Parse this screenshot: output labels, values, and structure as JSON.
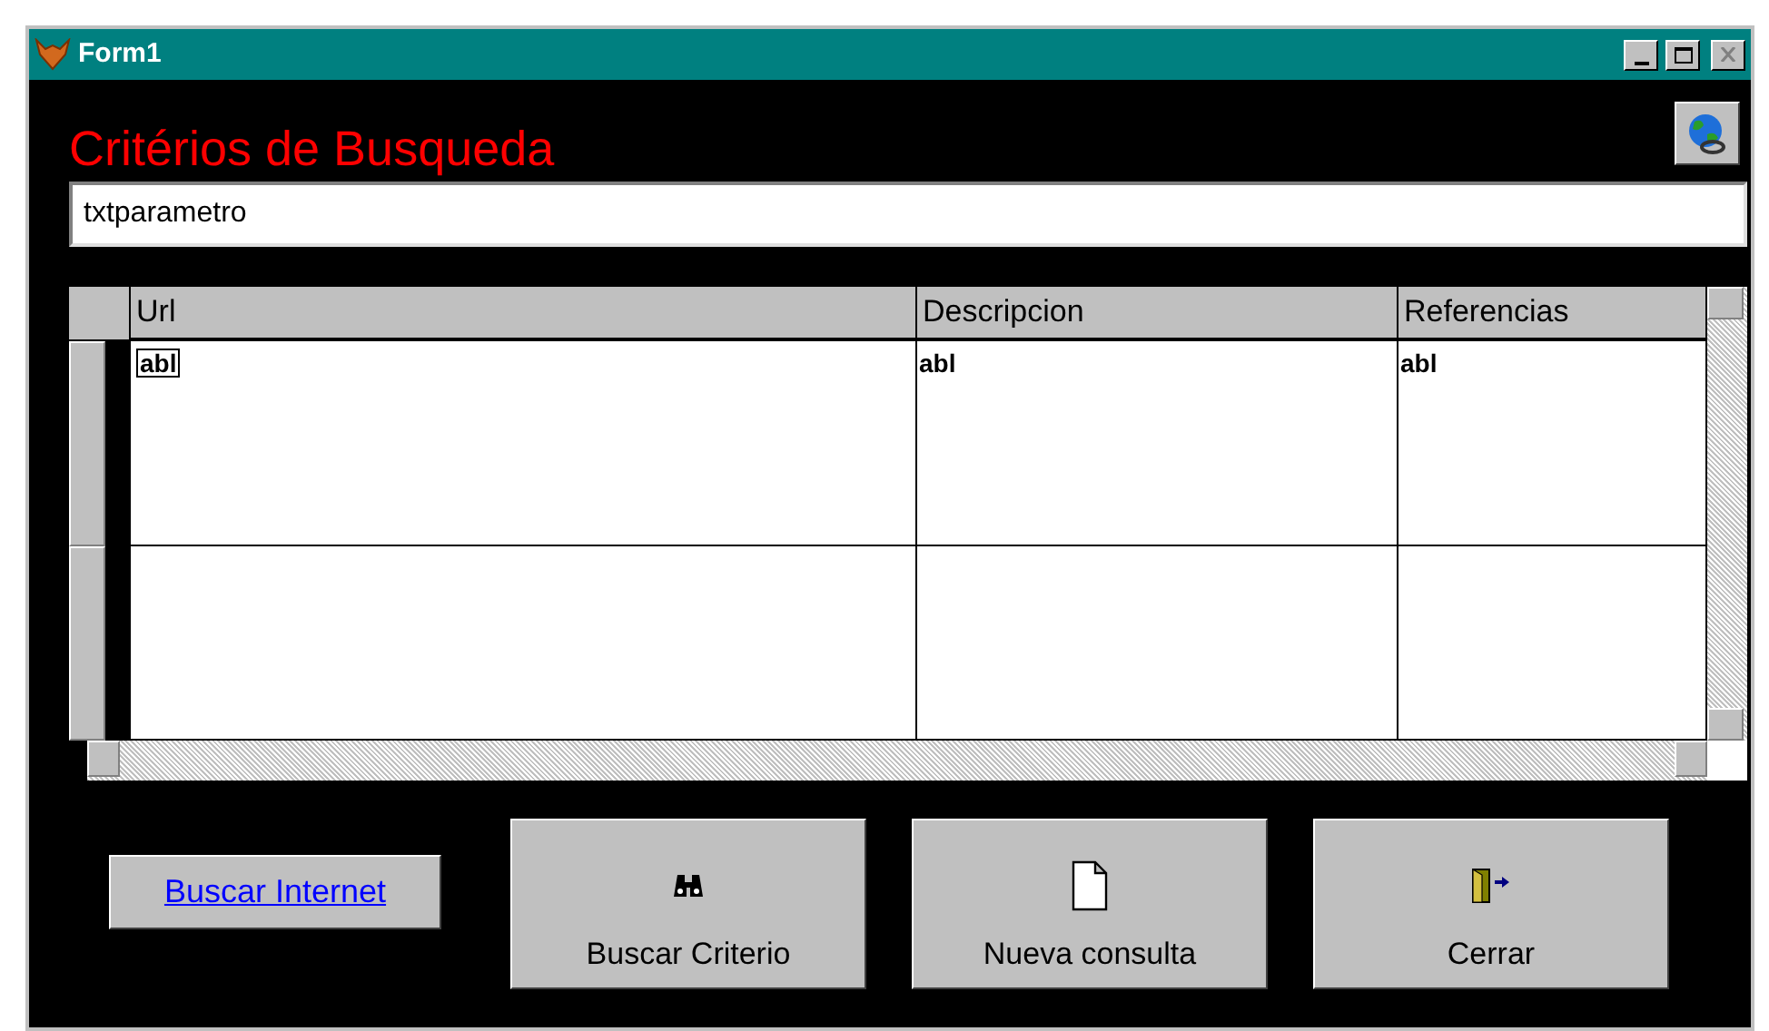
{
  "window": {
    "title": "Form1"
  },
  "heading": "Critérios de Busqueda",
  "search": {
    "value": "txtparametro"
  },
  "grid": {
    "columns": [
      "Url",
      "Descripcion",
      "Referencias"
    ],
    "rows": [
      {
        "cells": [
          {
            "text": "abl",
            "focused": true
          },
          {
            "text": "abl",
            "focused": false
          },
          {
            "text": "abl",
            "focused": false
          }
        ]
      },
      {
        "cells": [
          {
            "text": "",
            "focused": false
          },
          {
            "text": "",
            "focused": false
          },
          {
            "text": "",
            "focused": false
          }
        ]
      }
    ]
  },
  "link": "Buscar Internet",
  "buttons": [
    {
      "label": "Buscar Criterio",
      "kind": "binoculars"
    },
    {
      "label": "Nueva consulta",
      "kind": "page"
    },
    {
      "label": "Cerrar",
      "kind": "exit"
    }
  ]
}
